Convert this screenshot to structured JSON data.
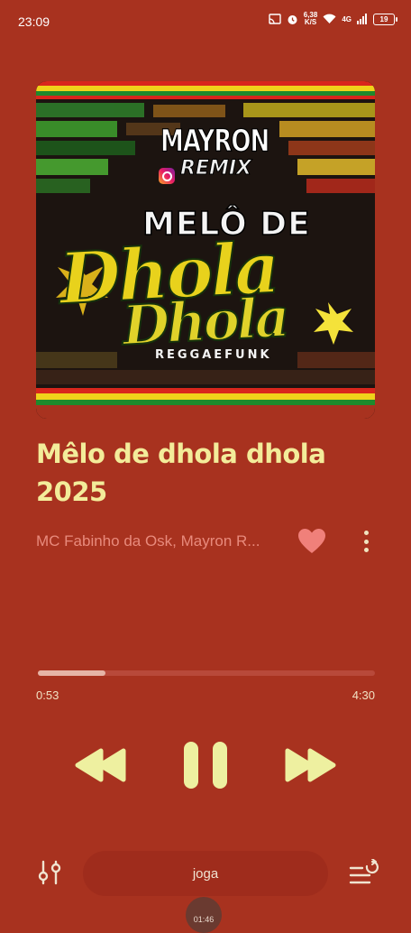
{
  "status_bar": {
    "time": "23:09",
    "net_speed_value": "6,38",
    "net_speed_unit": "K/S",
    "network": "4G",
    "battery": "19"
  },
  "cover": {
    "brand": "MAYRON",
    "brand_sub": "REMIX",
    "line1": "MELÔ DE",
    "line2": "Dhola",
    "line3": "Dhola",
    "genre": "REGGAEFUNK"
  },
  "track": {
    "title": "Mêlo de dhola dhola 2025",
    "artist": "MC Fabinho da Osk, Mayron R..."
  },
  "player": {
    "elapsed": "0:53",
    "total": "4:30",
    "progress_fraction": 0.2
  },
  "bottom_bar": {
    "lyrics_label": "joga",
    "indicator_time": "01:46"
  },
  "colors": {
    "background": "#a8321f",
    "title": "#f3ec9a",
    "artist": "#e88a7c",
    "heart": "#f0807a",
    "controls": "#eef0a0"
  },
  "icons": [
    "cast-icon",
    "alarm-icon",
    "wifi-icon",
    "signal-icon",
    "battery-icon",
    "heart-icon",
    "more-vert-icon",
    "previous-icon",
    "pause-icon",
    "next-icon",
    "equalizer-icon",
    "queue-icon"
  ]
}
